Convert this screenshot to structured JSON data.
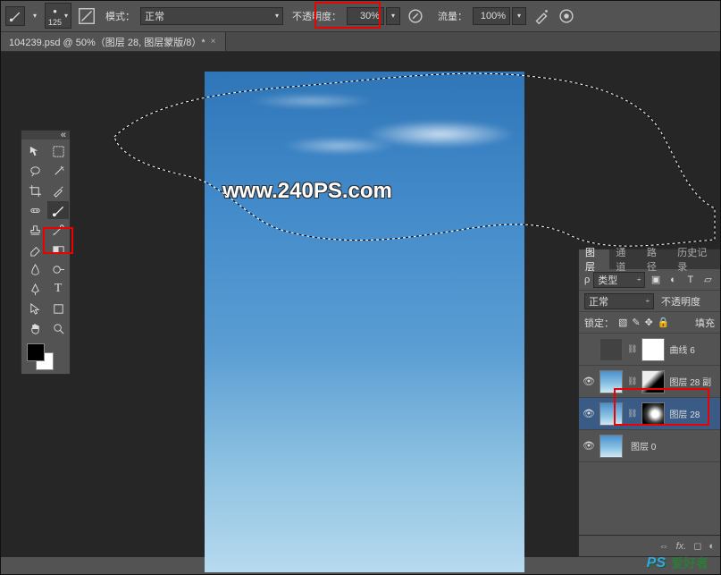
{
  "optionsBar": {
    "brushSize": "125",
    "modeLabel": "模式：",
    "modeValue": "正常",
    "opacityLabel": "不透明度：",
    "opacityValue": "30%",
    "flowLabel": "流量：",
    "flowValue": "100%"
  },
  "docTab": {
    "title": "104239.psd @ 50%（图层 28, 图层蒙版/8）*"
  },
  "watermark": "www.240PS.com",
  "toolbox": {
    "collapse": "«"
  },
  "layersPanel": {
    "tabs": [
      "图层",
      "通道",
      "路径",
      "历史记录"
    ],
    "kindLabel": "类型",
    "blendMode": "正常",
    "opacityLabel": "不透明度",
    "lockLabel": "锁定：",
    "fillLabel": "填充",
    "layers": [
      {
        "name": "曲线 6"
      },
      {
        "name": "图层 28 副"
      },
      {
        "name": "图层 28"
      },
      {
        "name": "图层 0"
      }
    ],
    "fxLabel": "fx."
  },
  "footer": {
    "mark": "PS",
    "text": "爱好者"
  }
}
